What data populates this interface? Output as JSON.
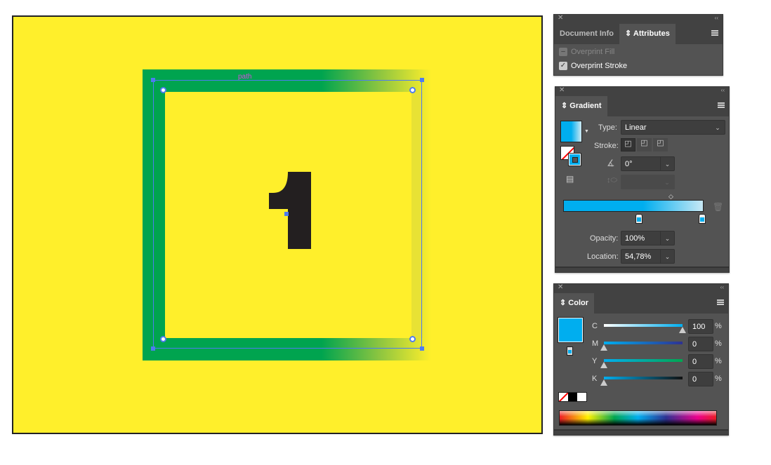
{
  "canvas": {
    "selection_label": "path",
    "digit": "1",
    "colors": {
      "background": "#ffef2b",
      "frame": "#00a44f",
      "digit": "#231f20",
      "selection": "#4e7cf0"
    }
  },
  "attributes_panel": {
    "tabs": [
      "Document Info",
      "Attributes"
    ],
    "active_tab": "Attributes",
    "overprint_fill": {
      "label": "Overprint Fill",
      "checked": false,
      "enabled": false
    },
    "overprint_stroke": {
      "label": "Overprint Stroke",
      "checked": true
    }
  },
  "gradient_panel": {
    "tab": "Gradient",
    "type_label": "Type:",
    "type_value": "Linear",
    "stroke_label": "Stroke:",
    "angle": "0°",
    "opacity_label": "Opacity:",
    "opacity": "100%",
    "location_label": "Location:",
    "location": "54,78%",
    "stop_color": "#00aeef",
    "midpoint_percent": 76
  },
  "color_panel": {
    "tab": "Color",
    "fill_color": "#00aeef",
    "channels": [
      {
        "label": "C",
        "value": "100",
        "unit": "%"
      },
      {
        "label": "M",
        "value": "0",
        "unit": "%"
      },
      {
        "label": "Y",
        "value": "0",
        "unit": "%"
      },
      {
        "label": "K",
        "value": "0",
        "unit": "%"
      }
    ]
  }
}
